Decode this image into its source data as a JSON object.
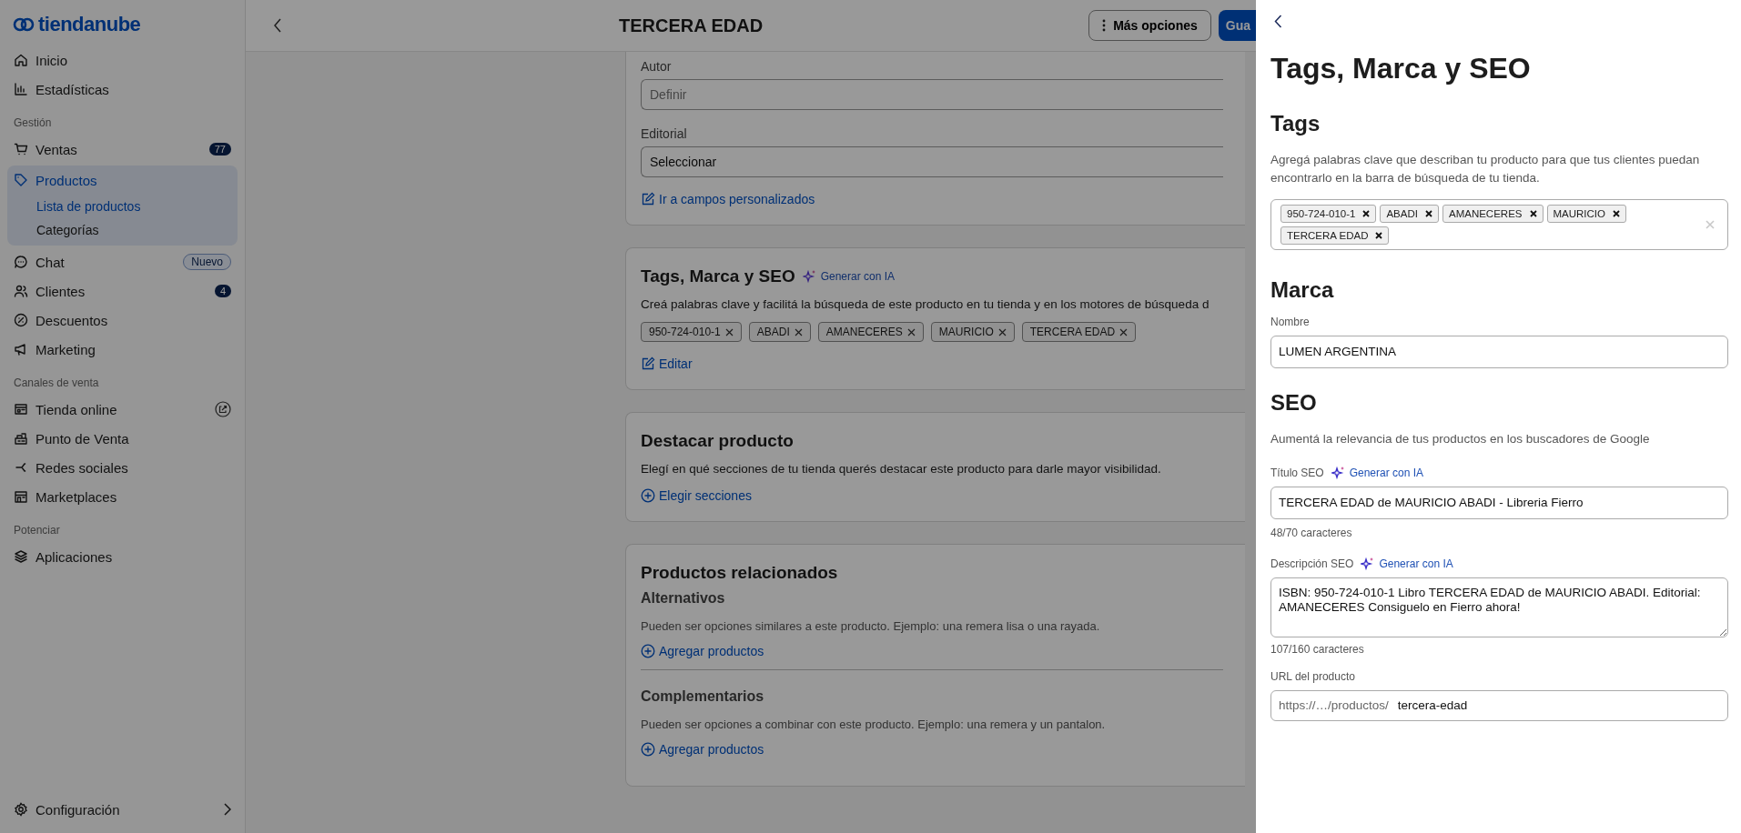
{
  "sidebar": {
    "logo": "tiendanube",
    "nav": [
      {
        "kind": "item",
        "label": "Inicio",
        "selected": false
      },
      {
        "kind": "item",
        "label": "Estadísticas",
        "selected": false
      },
      {
        "kind": "heading",
        "label": "Gestión"
      },
      {
        "kind": "item",
        "label": "Ventas",
        "selected": false,
        "badge": {
          "kind": "count",
          "text": "77"
        }
      },
      {
        "kind": "item",
        "label": "Productos",
        "selected": true,
        "expanded": true,
        "children": [
          {
            "label": "Lista de productos",
            "selected": true
          },
          {
            "label": "Categorías",
            "selected": false
          }
        ]
      },
      {
        "kind": "item",
        "label": "Chat",
        "selected": false,
        "badge": {
          "kind": "tag",
          "text": "Nuevo"
        }
      },
      {
        "kind": "item",
        "label": "Clientes",
        "selected": false,
        "badge": {
          "kind": "count",
          "text": "4"
        }
      },
      {
        "kind": "item",
        "label": "Descuentos",
        "selected": false
      },
      {
        "kind": "item",
        "label": "Marketing",
        "selected": false
      },
      {
        "kind": "heading",
        "label": "Canales de venta"
      },
      {
        "kind": "item",
        "label": "Tienda online",
        "selected": false
      },
      {
        "kind": "item",
        "label": "Punto de Venta",
        "selected": false
      },
      {
        "kind": "item",
        "label": "Redes sociales",
        "selected": false
      },
      {
        "kind": "item",
        "label": "Marketplaces",
        "selected": false
      },
      {
        "kind": "heading",
        "label": "Potenciar"
      },
      {
        "kind": "item",
        "label": "Aplicaciones",
        "selected": false
      }
    ],
    "footer": {
      "label": "Configuración"
    }
  },
  "header": {
    "title": "TERCERA EDAD",
    "buttons": [
      {
        "kind": "secondary",
        "label": "Más opciones"
      },
      {
        "kind": "primary",
        "label": "Gua"
      }
    ]
  },
  "cards": [
    {
      "kind": "fields",
      "fields": [
        {
          "kind": "input",
          "label": "Autor",
          "placeholder": "Definir"
        },
        {
          "kind": "select",
          "label": "Editorial",
          "value": "Seleccionar"
        }
      ],
      "link": "Ir a campos personalizados"
    },
    {
      "kind": "tags",
      "title": "Tags, Marca y SEO",
      "ai_link": "Generar con IA",
      "description": "Creá palabras clave y facilitá la búsqueda de este producto en tu tienda y en los motores de búsqueda d",
      "tags": [
        "950-724-010-1",
        "ABADI",
        "AMANECERES",
        "MAURICIO",
        "TERCERA EDAD"
      ],
      "link": "Editar"
    },
    {
      "kind": "feature",
      "title": "Destacar producto",
      "description": "Elegí en qué secciones de tu tienda querés destacar este producto para darle mayor visibilidad.",
      "link": "Elegir secciones"
    },
    {
      "kind": "related",
      "title": "Productos relacionados",
      "groups": [
        {
          "title": "Alternativos",
          "description": "Pueden ser opciones similares a este producto. Ejemplo: una remera lisa o una rayada.",
          "link": "Agregar productos"
        },
        {
          "title": "Complementarios",
          "description": "Pueden ser opciones a combinar con este producto. Ejemplo: una remera y un pantalon.",
          "link": "Agregar productos"
        }
      ]
    }
  ],
  "panel": {
    "title": "Tags, Marca y SEO",
    "tags_section": {
      "heading": "Tags",
      "description": "Agregá palabras clave que describan tu producto para que tus clientes puedan encontrarlo en la barra de búsqueda de tu tienda.",
      "tags": [
        "950-724-010-1",
        "ABADI",
        "AMANECERES",
        "MAURICIO",
        "TERCERA EDAD"
      ]
    },
    "brand": {
      "heading": "Marca",
      "label": "Nombre",
      "value": "LUMEN ARGENTINA"
    },
    "seo": {
      "heading": "SEO",
      "description": "Aumentá la relevancia de tus productos en los buscadores de Google",
      "title_field": {
        "label": "Título SEO",
        "ai_link": "Generar con IA",
        "value": "TERCERA EDAD de MAURICIO ABADI - Libreria Fierro",
        "counter": "48/70 caracteres"
      },
      "description_field": {
        "label": "Descripción SEO",
        "ai_link": "Generar con IA",
        "value": "ISBN: 950-724-010-1 Libro TERCERA EDAD de MAURICIO ABADI. Editorial: AMANECERES Consiguelo en Fierro ahora!",
        "counter": "107/160 caracteres"
      },
      "url_field": {
        "label": "URL del producto",
        "prefix": "https://…/productos/",
        "value": "tercera-edad"
      }
    }
  }
}
